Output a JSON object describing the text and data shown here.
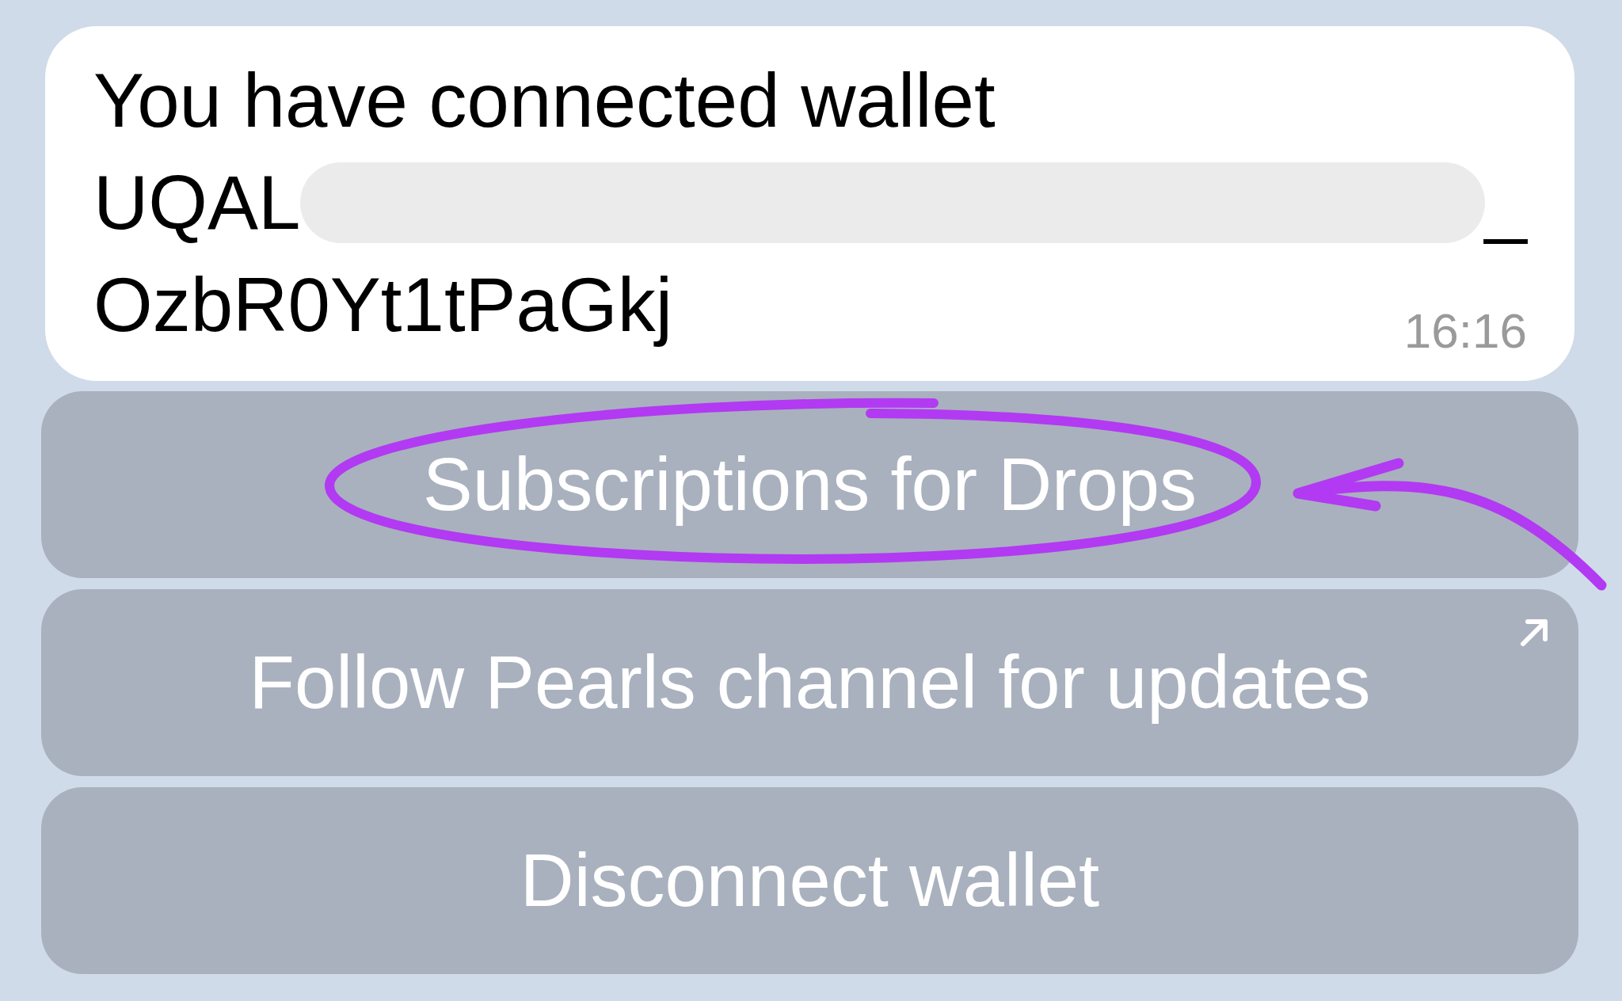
{
  "message": {
    "heading": "You have connected wallet",
    "address_start": "UQAL",
    "address_redacted": true,
    "address_end": "_",
    "address_continued": "OzbR0Yt1tPaGkj",
    "time": "16:16"
  },
  "keyboard": [
    {
      "label": "Subscriptions for Drops",
      "opens_link": false,
      "circled": true
    },
    {
      "label": "Follow Pearls channel for updates",
      "opens_link": true,
      "circled": false
    },
    {
      "label": "Disconnect wallet",
      "opens_link": false,
      "circled": false
    }
  ]
}
